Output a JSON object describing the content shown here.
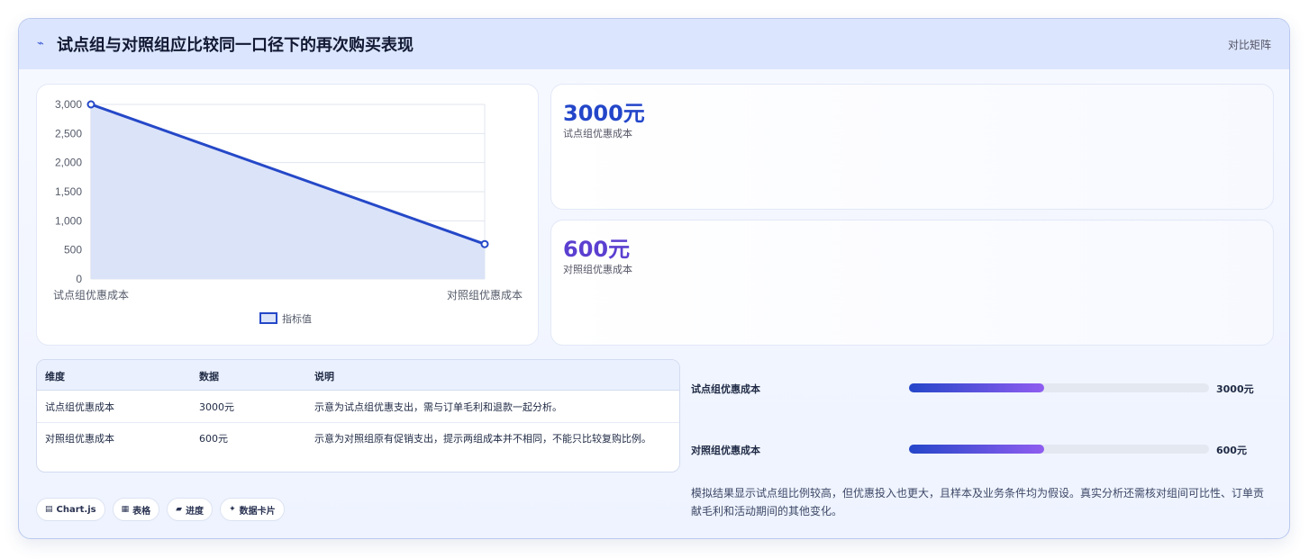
{
  "header": {
    "icon": "pulse-icon",
    "title": "试点组与对照组应比较同一口径下的再次购买表现",
    "badge": "对比矩阵"
  },
  "chart_data": {
    "type": "area",
    "categories": [
      "试点组优惠成本",
      "对照组优惠成本"
    ],
    "series": [
      {
        "name": "指标值",
        "values": [
          3000,
          600
        ]
      }
    ],
    "ylim": [
      0,
      3000
    ],
    "yticks": [
      "3,000",
      "2,500",
      "2,000",
      "1,500",
      "1,000",
      "500",
      "0"
    ],
    "ytick_values": [
      3000,
      2500,
      2000,
      1500,
      1000,
      500,
      0
    ],
    "grid": true,
    "legend": "bottom",
    "color": "#2548c8",
    "fill": "#dbe3f8"
  },
  "stats": [
    {
      "value": "3000元",
      "label": "试点组优惠成本"
    },
    {
      "value": "600元",
      "label": "对照组优惠成本"
    }
  ],
  "table": {
    "headers": [
      "维度",
      "数据",
      "说明"
    ],
    "rows": [
      [
        "试点组优惠成本",
        "3000元",
        "示意为试点组优惠支出，需与订单毛利和退款一起分析。"
      ],
      [
        "对照组优惠成本",
        "600元",
        "示意为对照组原有促销支出，提示两组成本并不相同，不能只比较复购比例。"
      ]
    ]
  },
  "progress": [
    {
      "label": "试点组优惠成本",
      "value": "3000元",
      "fraction": 0.45
    },
    {
      "label": "对照组优惠成本",
      "value": "600元",
      "fraction": 0.45
    }
  ],
  "chips": [
    {
      "icon": "chart-icon",
      "glyph": "▤",
      "label": "Chart.js"
    },
    {
      "icon": "table-icon",
      "glyph": "▦",
      "label": "表格"
    },
    {
      "icon": "progress-icon",
      "glyph": "▰",
      "label": "进度"
    },
    {
      "icon": "sparkle-icon",
      "glyph": "✦",
      "label": "数据卡片"
    }
  ],
  "note": "模拟结果显示试点组比例较高，但优惠投入也更大，且样本及业务条件均为假设。真实分析还需核对组间可比性、订单贡献毛利和活动期间的其他变化。"
}
